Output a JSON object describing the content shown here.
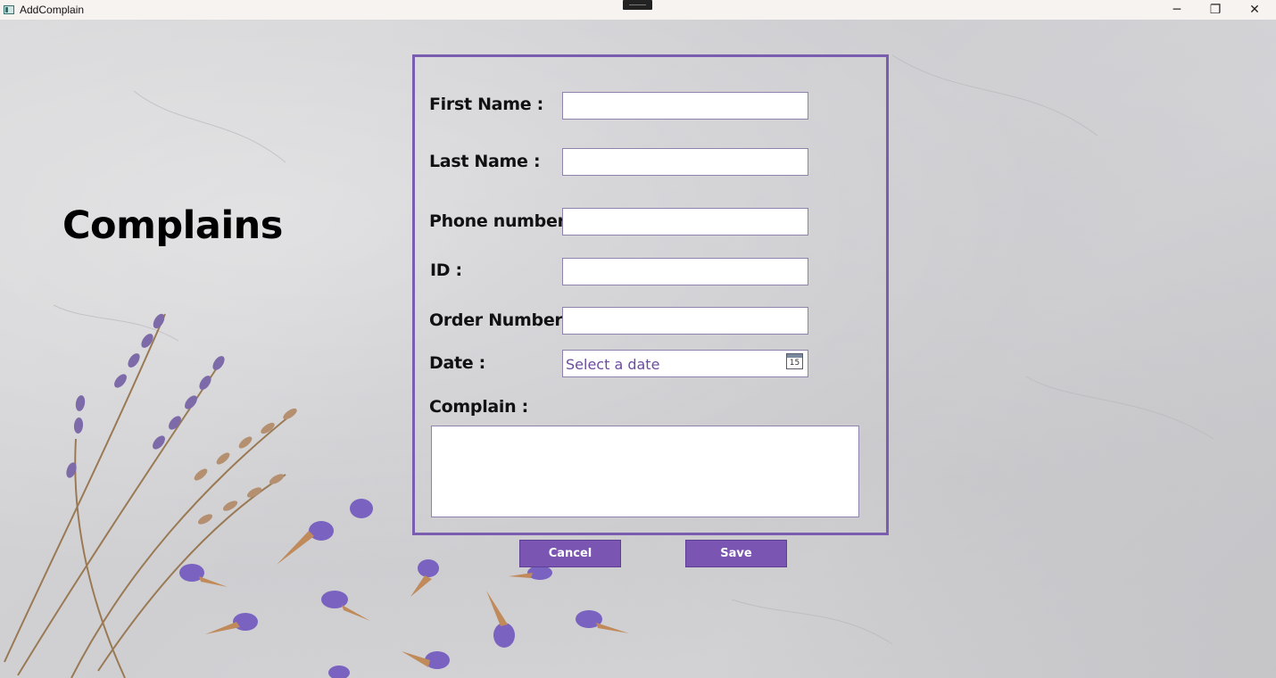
{
  "window": {
    "title": "AddComplain",
    "minimize_glyph": "─",
    "maximize_glyph": "❐",
    "close_glyph": "✕"
  },
  "page": {
    "heading": "Complains"
  },
  "form": {
    "first_name_label": "First Name :",
    "first_name_value": "",
    "last_name_label": "Last Name :",
    "last_name_value": "",
    "phone_label": "Phone number :",
    "phone_value": "",
    "id_label": "ID :",
    "id_value": "",
    "order_label": "Order Number :",
    "order_value": "",
    "date_label": "Date :",
    "date_placeholder": "Select a date",
    "calendar_day": "15",
    "complain_label": "Complain :",
    "complain_value": ""
  },
  "buttons": {
    "cancel_label": "Cancel",
    "save_label": "Save"
  },
  "colors": {
    "accent": "#7b55b2",
    "panel_border": "#7a5cb0",
    "placeholder": "#6b4c9e"
  }
}
